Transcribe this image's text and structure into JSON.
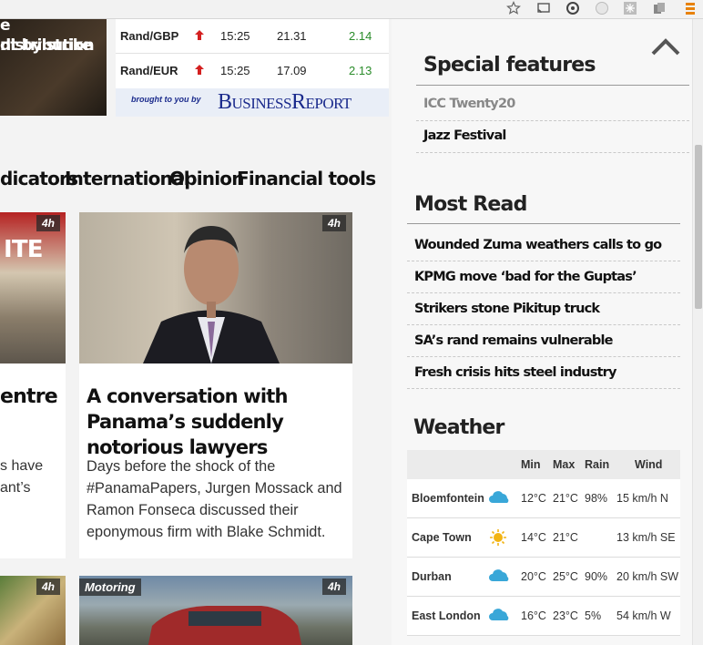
{
  "currency": {
    "rows": [
      {
        "pair": "Rand/GBP",
        "time": "15:25",
        "rate": "21.31",
        "change": "2.14"
      },
      {
        "pair": "Rand/EUR",
        "time": "15:25",
        "rate": "17.09",
        "change": "2.13"
      }
    ],
    "sponsor_prefix": "brought to you by",
    "sponsor_name": "BusinessReport"
  },
  "hero_caption": {
    "line1": "e distribution",
    "line2": "nt by strike"
  },
  "nav": {
    "items": [
      "dicators",
      "International",
      "Opinion",
      "Financial tools"
    ]
  },
  "cards": {
    "left_badge": "4h",
    "left_title": "entre",
    "left_text_line1": "s have",
    "left_text_line2": "ant’s",
    "main_badge": "4h",
    "main_title": "A conversation with Panama’s suddenly notorious lawyers",
    "main_text": "Days before the shock of the #PanamaPapers, Jurgen Mossack and Ramon Fonseca discussed their eponymous firm with Blake Schmidt.",
    "bottom_left_badge": "4h",
    "bottom_main_category": "Motoring",
    "bottom_main_badge": "4h"
  },
  "special_features": {
    "title": "Special features",
    "items": [
      {
        "label": "ICC Twenty20",
        "muted": true
      },
      {
        "label": "Jazz Festival",
        "muted": false
      }
    ]
  },
  "most_read": {
    "title": "Most Read",
    "items": [
      "Wounded Zuma weathers calls to go",
      "KPMG move ‘bad for the Guptas’",
      "Strikers stone Pikitup truck",
      "SA’s rand remains vulnerable",
      "Fresh crisis hits steel industry"
    ]
  },
  "weather": {
    "title": "Weather",
    "headers": {
      "min": "Min",
      "max": "Max",
      "rain": "Rain",
      "wind": "Wind"
    },
    "rows": [
      {
        "city": "Bloemfontein",
        "icon": "rain-cloud-icon",
        "min": "12°C",
        "max": "21°C",
        "rain": "98%",
        "wind": "15 km/h N"
      },
      {
        "city": "Cape Town",
        "icon": "sun-icon",
        "min": "14°C",
        "max": "21°C",
        "rain": "",
        "wind": "13 km/h SE"
      },
      {
        "city": "Durban",
        "icon": "rain-cloud-icon",
        "min": "20°C",
        "max": "25°C",
        "rain": "90%",
        "wind": "20 km/h SW"
      },
      {
        "city": "East London",
        "icon": "rain-cloud-icon",
        "min": "16°C",
        "max": "23°C",
        "rain": "5%",
        "wind": "54 km/h W"
      }
    ]
  },
  "colors": {
    "positive_change": "#2a8c2a",
    "up_arrow": "#d42020",
    "sponsor_blue": "#1a2a8c"
  }
}
